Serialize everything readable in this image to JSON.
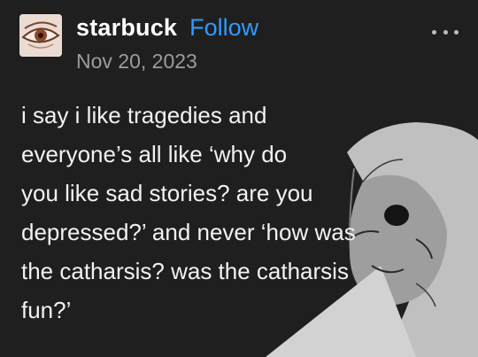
{
  "post": {
    "author": {
      "username": "starbuck",
      "follow_label": "Follow",
      "avatar_icon": "eye-drawing-avatar"
    },
    "date": "Nov 20, 2023",
    "more_icon": "more-options-icon",
    "body_lines": [
      "i say i like tragedies and",
      "everyone’s all like ‘why do",
      "you like sad stories? are you",
      "depressed?’ and never ‘how was",
      "the catharsis? was the catharsis",
      "fun?’"
    ]
  },
  "colors": {
    "background": "#1f1f1f",
    "follow": "#2f9bff",
    "date": "#9c9c9c",
    "text": "#f2f2f2"
  }
}
